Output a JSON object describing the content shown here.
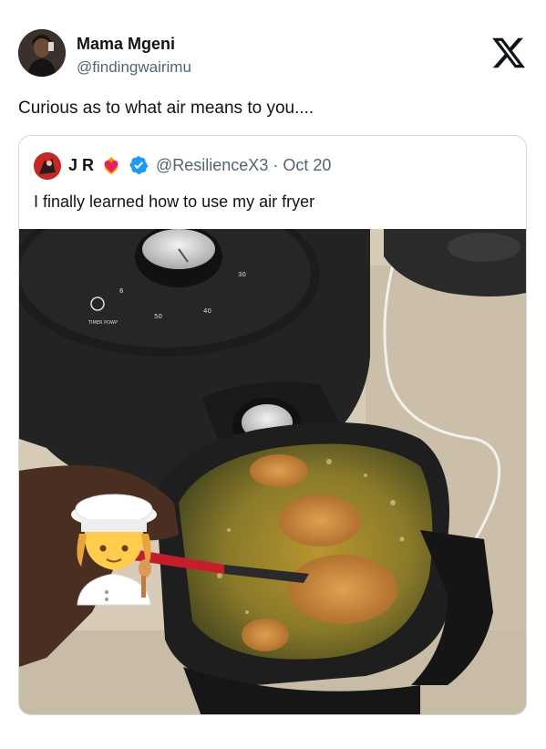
{
  "tweet": {
    "author_name": "Mama Mgeni",
    "author_handle": "@findingwairimu",
    "text": "Curious as to what air means to you...."
  },
  "quoted_tweet": {
    "author_name": "J R",
    "author_handle": "@ResilienceX3 · Oct 20",
    "text": "I finally learned how to use my air fryer",
    "media": {
      "dial_labels": [
        "6",
        "50",
        "40",
        "30",
        "TIMER POWP"
      ]
    }
  },
  "icons": {
    "platform_logo": "x-logo-icon",
    "verified": "verified-badge-icon",
    "heart_emoji": "heart-on-fire-icon",
    "cook_emoji": "cook-emoji-icon"
  },
  "colors": {
    "text_primary": "#0f1419",
    "text_secondary": "#536471",
    "border": "#cfd9de",
    "verified_blue": "#1d9bf0"
  }
}
